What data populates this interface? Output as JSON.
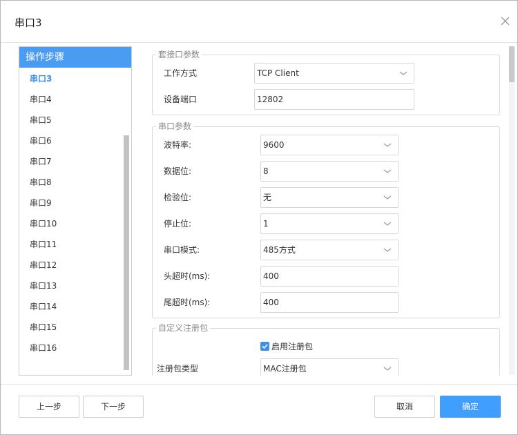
{
  "dialog": {
    "title": "串口3"
  },
  "steps": {
    "header": "操作步骤",
    "items": [
      "串口3",
      "串口4",
      "串口5",
      "串口6",
      "串口7",
      "串口8",
      "串口9",
      "串口10",
      "串口11",
      "串口12",
      "串口13",
      "串口14",
      "串口15",
      "串口16"
    ],
    "active_index": 0
  },
  "socket": {
    "legend": "套接口参数",
    "mode_label": "工作方式",
    "mode_value": "TCP Client",
    "port_label": "设备端口",
    "port_value": "12802"
  },
  "serial": {
    "legend": "串口参数",
    "baud_label": "波特率:",
    "baud_value": "9600",
    "databits_label": "数据位:",
    "databits_value": "8",
    "parity_label": "检验位:",
    "parity_value": "无",
    "stopbits_label": "停止位:",
    "stopbits_value": "1",
    "mode_label": "串口模式:",
    "mode_value": "485方式",
    "head_timeout_label": "头超时(ms):",
    "head_timeout_value": "400",
    "tail_timeout_label": "尾超时(ms):",
    "tail_timeout_value": "400"
  },
  "register": {
    "legend": "自定义注册包",
    "enable_label": "启用注册包",
    "enable_checked": true,
    "type_label": "注册包类型",
    "type_value": "MAC注册包"
  },
  "footer": {
    "prev_label": "上一步",
    "next_label": "下一步",
    "cancel_label": "取消",
    "confirm_label": "确定"
  },
  "colors": {
    "accent": "#409eff",
    "steps_header": "#4a9cf2"
  },
  "icons": {
    "close": "close-icon",
    "dropdown": "chevron-down-icon",
    "check": "check-icon"
  }
}
